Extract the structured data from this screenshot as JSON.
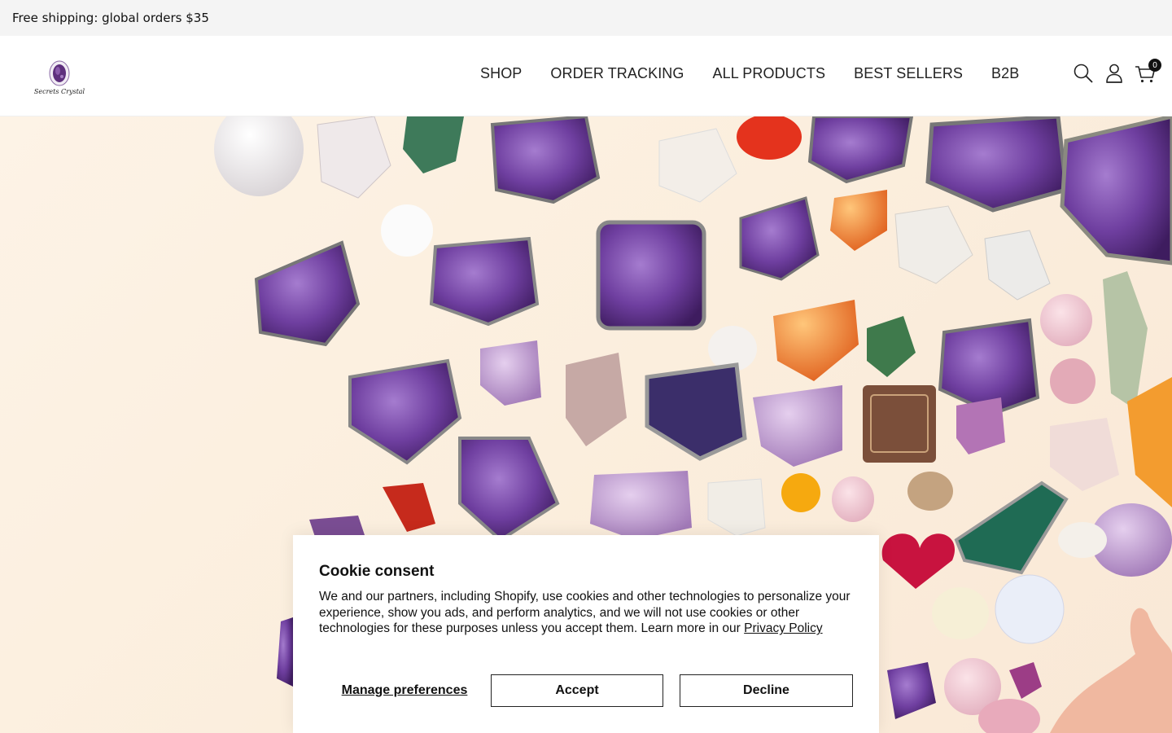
{
  "announcement": {
    "text": "Free shipping: global orders $35"
  },
  "header": {
    "logo_text": "Secrets Crystal",
    "nav": [
      {
        "label": "SHOP"
      },
      {
        "label": "ORDER TRACKING"
      },
      {
        "label": "ALL PRODUCTS"
      },
      {
        "label": "BEST SELLERS"
      },
      {
        "label": "B2B"
      }
    ],
    "icons": [
      "search-icon",
      "account-icon",
      "cart-icon"
    ],
    "cart_count": "0"
  },
  "hero": {
    "image": "assorted-crystals-photo"
  },
  "cookie": {
    "title": "Cookie consent",
    "body": "We and our partners, including Shopify, use cookies and other technologies to personalize your experience, show you ads, and perform analytics, and we will not use cookies or other technologies for these purposes unless you accept them. Learn more in our ",
    "privacy_link": "Privacy Policy",
    "manage_label": "Manage preferences",
    "accept_label": "Accept",
    "decline_label": "Decline"
  },
  "colors": {
    "accent": "#6b3fa0",
    "announcement_bg": "#f4f4f4",
    "hero_bg": "#fbeedd"
  }
}
